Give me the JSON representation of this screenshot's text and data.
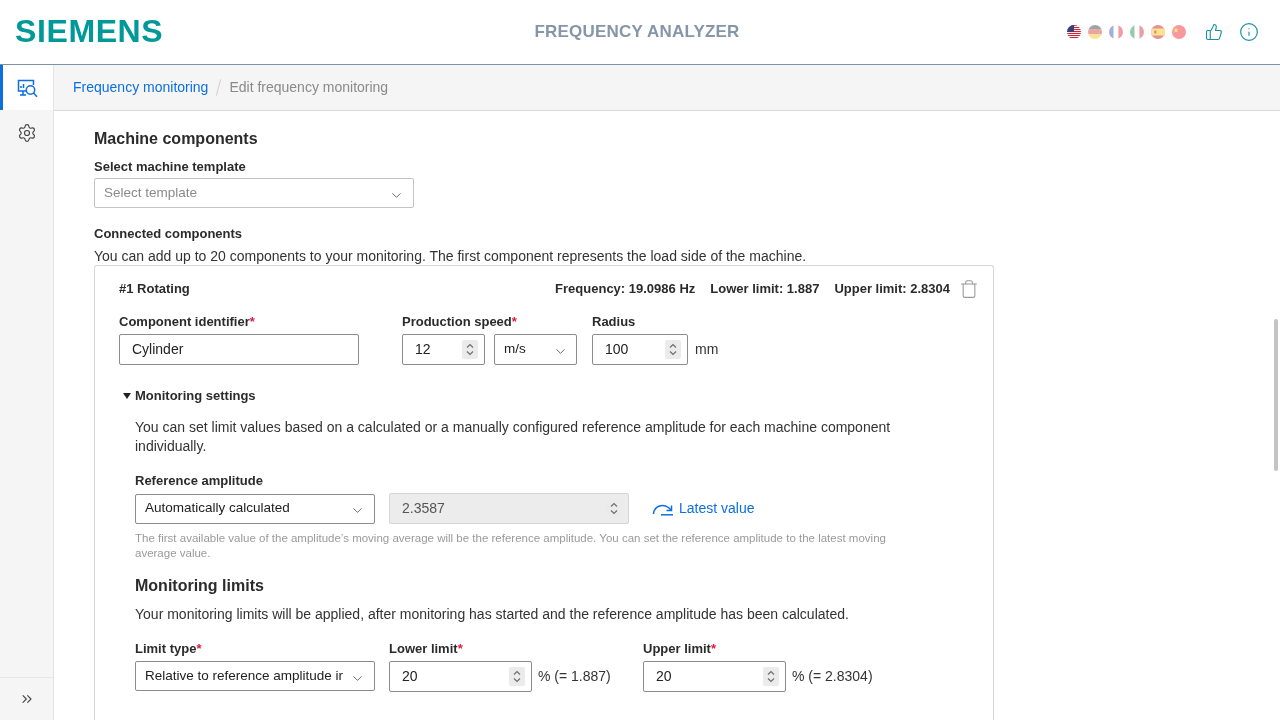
{
  "header": {
    "logo": "SIEMENS",
    "title": "FREQUENCY ANALYZER",
    "languages": [
      {
        "kind": "us",
        "selected": true
      },
      {
        "kind": "de",
        "selected": false
      },
      {
        "kind": "fr",
        "selected": false
      },
      {
        "kind": "it",
        "selected": false
      },
      {
        "kind": "es",
        "selected": false
      },
      {
        "kind": "cn",
        "selected": false
      }
    ]
  },
  "sidebar": {
    "items": [
      {
        "kind": "monitoring",
        "selected": true
      },
      {
        "kind": "settings",
        "selected": false
      }
    ]
  },
  "breadcrumb": [
    {
      "label": "Frequency monitoring",
      "kind": "link"
    },
    {
      "label": "Edit frequency monitoring",
      "kind": "current"
    }
  ],
  "machine_components": {
    "title": "Machine components",
    "template": {
      "label": "Select machine template",
      "placeholder": "Select template"
    },
    "connected": {
      "title": "Connected components",
      "description": "You can add up to 20 components to your monitoring. The first component represents the load side of the machine."
    },
    "components": [
      {
        "title": "#1 Rotating",
        "stats": [
          "Frequency: 19.0986 Hz",
          "Lower limit: 1.887",
          "Upper limit: 2.8304"
        ],
        "identifier": {
          "label": "Component identifier",
          "required_mark": "*",
          "value": "Cylinder"
        },
        "production_speed": {
          "label": "Production speed",
          "required_mark": "*",
          "value": "12",
          "unit": "m/s"
        },
        "radius": {
          "label": "Radius",
          "value": "100",
          "unit": "mm"
        },
        "monitoring_settings": {
          "title": "Monitoring settings",
          "expanded": true,
          "description": "You can set limit values based on a calculated or a manually configured reference amplitude for each machine component individually.",
          "reference_amplitude": {
            "label": "Reference amplitude",
            "mode": "Automatically calculated",
            "value": "2.3587",
            "disabled": true,
            "action": "Latest value",
            "hint": "The first available value of the amplitude’s moving average will be the reference amplitude. You can set the reference amplitude to the latest moving average value."
          },
          "limits": {
            "title": "Monitoring limits",
            "description": "Your monitoring limits will be applied, after monitoring has started and the reference amplitude has been calculated.",
            "limit_type": {
              "label": "Limit type",
              "required_mark": "*",
              "value": "Relative to reference amplitude ir"
            },
            "lower": {
              "label": "Lower limit",
              "required_mark": "*",
              "value": "20",
              "result": "% (= 1.887)"
            },
            "upper": {
              "label": "Upper limit",
              "required_mark": "*",
              "value": "20",
              "result": "% (= 2.8304)"
            }
          }
        }
      }
    ]
  }
}
